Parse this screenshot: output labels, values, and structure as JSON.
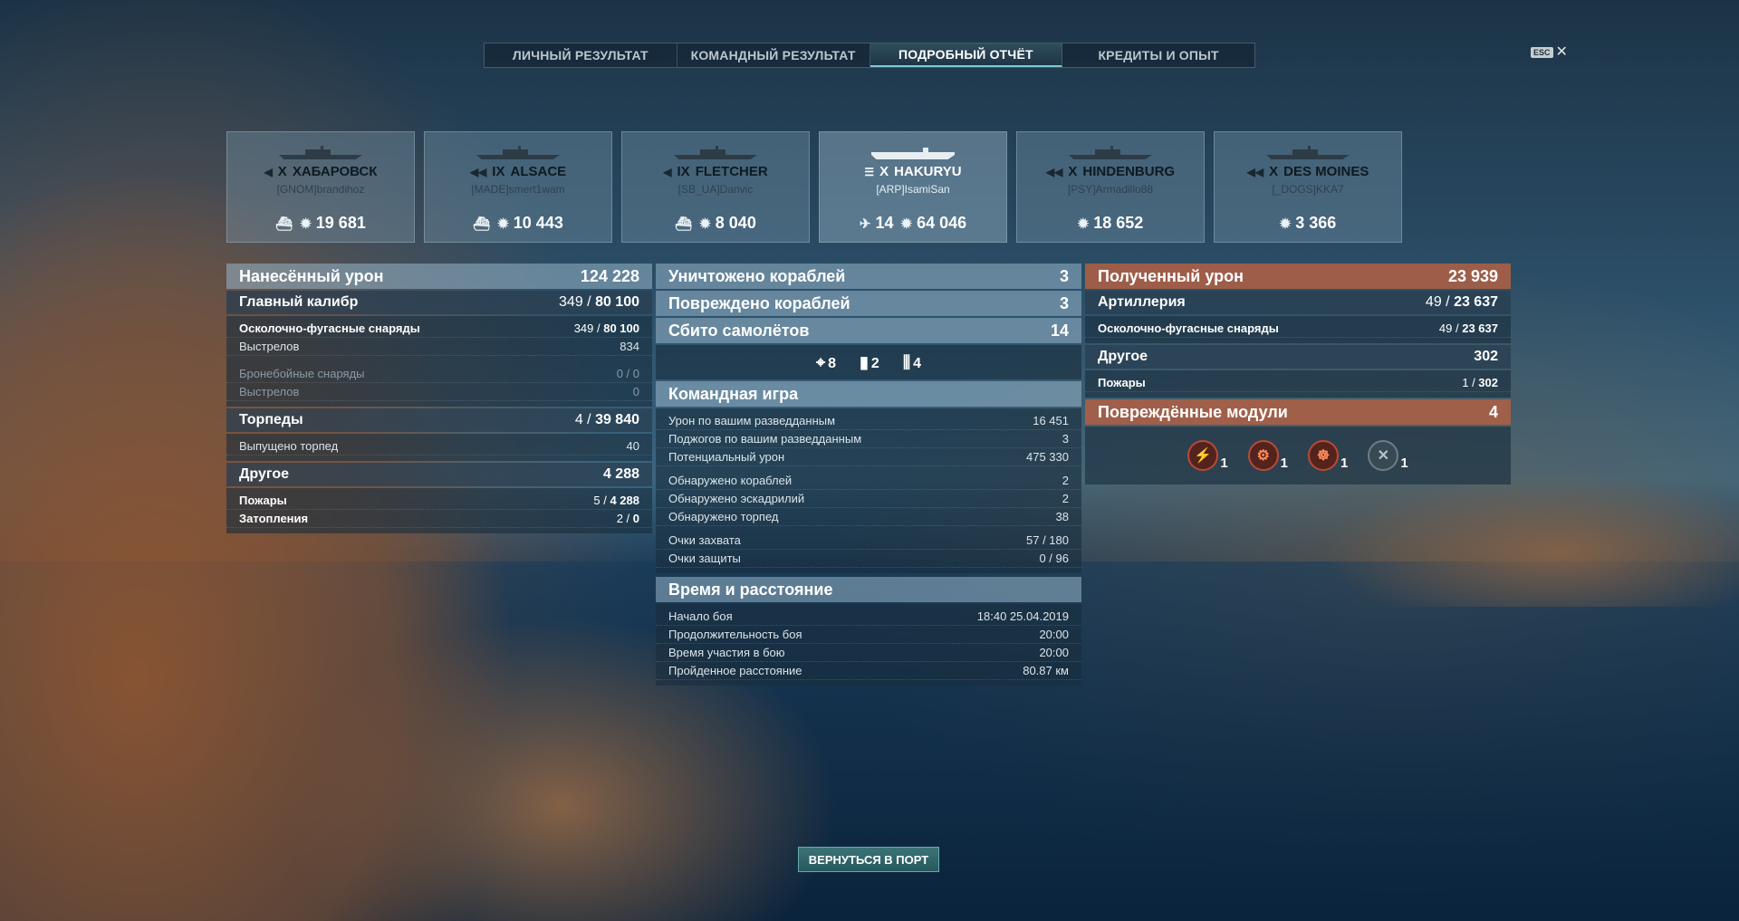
{
  "tabs": [
    "ЛИЧНЫЙ РЕЗУЛЬТАТ",
    "КОМАНДНЫЙ РЕЗУЛЬТАТ",
    "ПОДРОБНЫЙ ОТЧЁТ",
    "КРЕДИТЫ И ОПЫТ"
  ],
  "esc": {
    "key": "ESC",
    "close": "✕"
  },
  "ships": [
    {
      "tier": "X",
      "name": "ХАБАРОВСК",
      "player": "[GNOM]brandihoz",
      "damage": "19 681",
      "ship_class": "destroyer"
    },
    {
      "tier": "IX",
      "name": "ALSACE",
      "player": "[MADE]smert1wam",
      "damage": "10 443",
      "ship_class": "battleship"
    },
    {
      "tier": "IX",
      "name": "FLETCHER",
      "player": "[SB_UA]Danvic",
      "damage": "8 040",
      "ship_class": "destroyer"
    },
    {
      "tier": "X",
      "name": "HAKURYU",
      "player": "[ARP]IsamiSan",
      "planes": "14",
      "damage": "64 046",
      "ship_class": "carrier"
    },
    {
      "tier": "X",
      "name": "HINDENBURG",
      "player": "[PSY]Armadillo88",
      "damage": "18 652",
      "ship_class": "cruiser"
    },
    {
      "tier": "X",
      "name": "DES MOINES",
      "player": "[_DOGS]KKA7",
      "damage": "3 366",
      "ship_class": "cruiser"
    }
  ],
  "dealt": {
    "title": "Нанесённый урон",
    "total": "124 228",
    "main": {
      "label": "Главный калибр",
      "hits": "349",
      "max": "80 100"
    },
    "he": {
      "label": "Осколочно-фугасные снаряды",
      "hits": "349",
      "max": "80 100"
    },
    "he_shots": {
      "label": "Выстрелов",
      "value": "834"
    },
    "ap": {
      "label": "Бронебойные снаряды",
      "value": "0 / 0"
    },
    "ap_shots": {
      "label": "Выстрелов",
      "value": "0"
    },
    "torp": {
      "label": "Торпеды",
      "hits": "4",
      "max": "39 840"
    },
    "torp_shots": {
      "label": "Выпущено торпед",
      "value": "40"
    },
    "other": {
      "label": "Другое",
      "value": "4 288"
    },
    "fires": {
      "label": "Пожары",
      "count": "5",
      "dmg": "4 288"
    },
    "floods": {
      "label": "Затопления",
      "count": "2",
      "dmg": "0"
    }
  },
  "center": {
    "destroyed": {
      "label": "Уничтожено кораблей",
      "value": "3"
    },
    "damaged": {
      "label": "Повреждено кораблей",
      "value": "3"
    },
    "planes": {
      "label": "Сбито самолётов",
      "value": "14"
    },
    "plane_types": [
      {
        "icon": "crosshair-icon",
        "count": "8"
      },
      {
        "icon": "bomb-icon",
        "count": "2"
      },
      {
        "icon": "torpedo-icon",
        "count": "4"
      }
    ],
    "team": {
      "title": "Командная игра",
      "rows": [
        {
          "label": "Урон по вашим разведданным",
          "value": "16 451"
        },
        {
          "label": "Поджогов по вашим разведданным",
          "value": "3"
        },
        {
          "label": "Потенциальный урон",
          "value": "475 330"
        }
      ],
      "rows2": [
        {
          "label": "Обнаружено кораблей",
          "value": "2"
        },
        {
          "label": "Обнаружено эскадрилий",
          "value": "2"
        },
        {
          "label": "Обнаружено торпед",
          "value": "38"
        }
      ],
      "rows3": [
        {
          "label": "Очки захвата",
          "value": "57 / 180"
        },
        {
          "label": "Очки защиты",
          "value": "0 / 96"
        }
      ]
    },
    "time": {
      "title": "Время и расстояние",
      "rows": [
        {
          "label": "Начало боя",
          "value": "18:40  25.04.2019"
        },
        {
          "label": "Продолжительность боя",
          "value": "20:00"
        },
        {
          "label": "Время участия в бою",
          "value": "20:00"
        },
        {
          "label": "Пройденное расстояние",
          "value": "80.87 км"
        }
      ]
    }
  },
  "received": {
    "title": "Полученный урон",
    "total": "23 939",
    "art": {
      "label": "Артиллерия",
      "hits": "49",
      "max": "23 637"
    },
    "he": {
      "label": "Осколочно-фугасные снаряды",
      "hits": "49",
      "max": "23 637"
    },
    "other": {
      "label": "Другое",
      "value": "302"
    },
    "fires": {
      "label": "Пожары",
      "count": "1",
      "dmg": "302"
    },
    "modules": {
      "title": "Повреждённые модули",
      "value": "4",
      "items": [
        {
          "icon": "main-battery-icon",
          "count": "1"
        },
        {
          "icon": "engine-icon",
          "count": "1"
        },
        {
          "icon": "steering-icon",
          "count": "1"
        },
        {
          "icon": "aa-gun-icon",
          "count": "1"
        }
      ]
    }
  },
  "back_button": "ВЕРНУТЬСЯ В ПОРТ"
}
